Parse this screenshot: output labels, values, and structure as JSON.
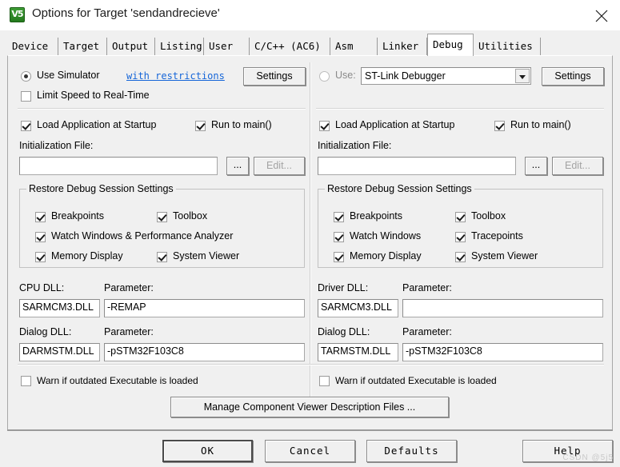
{
  "window": {
    "title": "Options for Target 'sendandrecieve'",
    "icon": "uvision-logo-icon",
    "close_label": "✕",
    "watermark": "CSDN @5j5"
  },
  "tabs": [
    {
      "label": "Device",
      "active": false
    },
    {
      "label": "Target",
      "active": false
    },
    {
      "label": "Output",
      "active": false
    },
    {
      "label": "Listing",
      "active": false
    },
    {
      "label": "User",
      "active": false
    },
    {
      "label": "C/C++ (AC6)",
      "active": false
    },
    {
      "label": "Asm",
      "active": false
    },
    {
      "label": "Linker",
      "active": false
    },
    {
      "label": "Debug",
      "active": true
    },
    {
      "label": "Utilities",
      "active": false
    }
  ],
  "left": {
    "radio_label": "Use Simulator",
    "radio_checked": true,
    "restrictions_link": "with restrictions",
    "settings_button": "Settings",
    "limit_speed_label": "Limit Speed to Real-Time",
    "limit_speed_checked": false,
    "load_app_label": "Load Application at Startup",
    "load_app_checked": true,
    "run_to_main_label": "Run to main()",
    "run_to_main_checked": true,
    "init_file_label": "Initialization File:",
    "init_file_value": "",
    "browse_button": "...",
    "edit_button": "Edit...",
    "group_title": "Restore Debug Session Settings",
    "checks": [
      {
        "label": "Breakpoints",
        "checked": true
      },
      {
        "label": "Toolbox",
        "checked": true
      },
      {
        "label": "Watch Windows & Performance Analyzer",
        "checked": true
      },
      {
        "label": "Memory Display",
        "checked": true
      },
      {
        "label": "System Viewer",
        "checked": true
      }
    ],
    "cpu_dll_label": "CPU DLL:",
    "cpu_dll_value": "SARMCM3.DLL",
    "cpu_param_label": "Parameter:",
    "cpu_param_value": "-REMAP",
    "dialog_dll_label": "Dialog DLL:",
    "dialog_dll_value": "DARMSTM.DLL",
    "dialog_param_label": "Parameter:",
    "dialog_param_value": "-pSTM32F103C8",
    "warn_label": "Warn if outdated Executable is loaded",
    "warn_checked": false
  },
  "right": {
    "radio_label": "Use:",
    "radio_checked": false,
    "debugger_selected": "ST-Link Debugger",
    "settings_button": "Settings",
    "load_app_label": "Load Application at Startup",
    "load_app_checked": true,
    "run_to_main_label": "Run to main()",
    "run_to_main_checked": true,
    "init_file_label": "Initialization File:",
    "init_file_value": "",
    "browse_button": "...",
    "edit_button": "Edit...",
    "group_title": "Restore Debug Session Settings",
    "checks": [
      {
        "label": "Breakpoints",
        "checked": true
      },
      {
        "label": "Toolbox",
        "checked": true
      },
      {
        "label": "Watch Windows",
        "checked": true
      },
      {
        "label": "Tracepoints",
        "checked": true
      },
      {
        "label": "Memory Display",
        "checked": true
      },
      {
        "label": "System Viewer",
        "checked": true
      }
    ],
    "driver_dll_label": "Driver DLL:",
    "driver_dll_value": "SARMCM3.DLL",
    "driver_param_label": "Parameter:",
    "driver_param_value": "",
    "dialog_dll_label": "Dialog DLL:",
    "dialog_dll_value": "TARMSTM.DLL",
    "dialog_param_label": "Parameter:",
    "dialog_param_value": "-pSTM32F103C8",
    "warn_label": "Warn if outdated Executable is loaded",
    "warn_checked": false
  },
  "manage_button": "Manage Component Viewer Description Files ...",
  "footer": {
    "ok": "OK",
    "cancel": "Cancel",
    "defaults": "Defaults",
    "help": "Help"
  }
}
